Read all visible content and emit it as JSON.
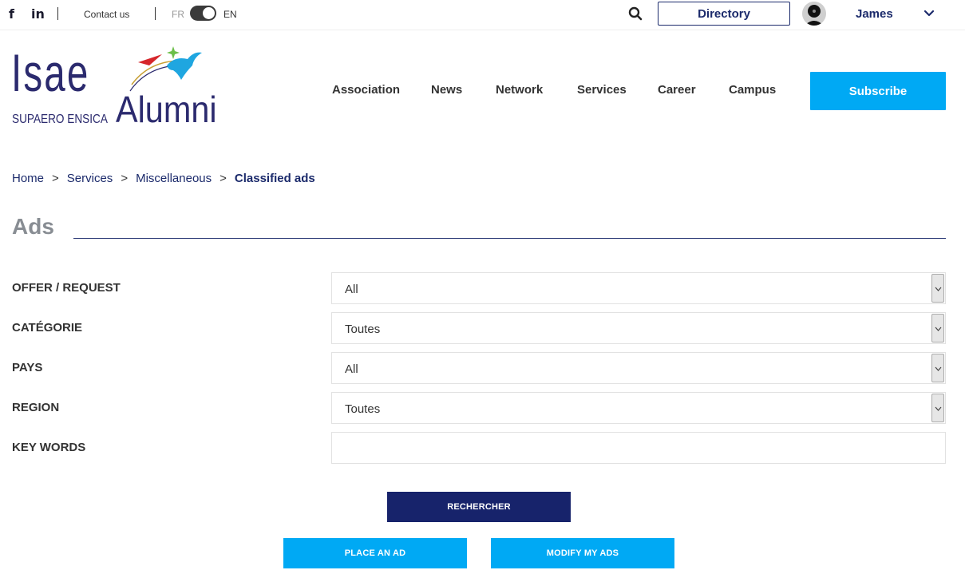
{
  "topbar": {
    "social": {
      "facebook": "f",
      "linkedin": "in"
    },
    "contact_label": "Contact us",
    "lang_fr": "FR",
    "lang_en": "EN",
    "directory_label": "Directory",
    "user_name": "James"
  },
  "logo": {
    "isae": "Isae",
    "schools": "SUPAERO  ENSICA",
    "alumni": "Alumni"
  },
  "nav": {
    "items": [
      {
        "label": "Association"
      },
      {
        "label": "News"
      },
      {
        "label": "Network"
      },
      {
        "label": "Services"
      },
      {
        "label": "Career"
      },
      {
        "label": "Campus"
      }
    ],
    "subscribe_label": "Subscribe"
  },
  "breadcrumb": {
    "items": [
      "Home",
      "Services",
      "Miscellaneous"
    ],
    "separator": ">",
    "current": "Classified ads"
  },
  "page": {
    "title": "Ads"
  },
  "form": {
    "offer_request": {
      "label": "OFFER / REQUEST",
      "value": "All"
    },
    "category": {
      "label": "CATÉGORIE",
      "value": "Toutes"
    },
    "country": {
      "label": "PAYS",
      "value": "All"
    },
    "region": {
      "label": "REGION",
      "value": "Toutes"
    },
    "keywords": {
      "label": "KEY WORDS",
      "value": "",
      "placeholder": ""
    },
    "search_label": "RECHERCHER",
    "place_ad_label": "PLACE AN AD",
    "modify_ads_label": "MODIFY MY ADS"
  },
  "colors": {
    "navy": "#1b2a6b",
    "accent_blue": "#00a9f4",
    "title_gray": "#888d93"
  },
  "icons": {
    "search": "search-icon",
    "chevron": "chevron-down-icon",
    "avatar": "avatar"
  }
}
